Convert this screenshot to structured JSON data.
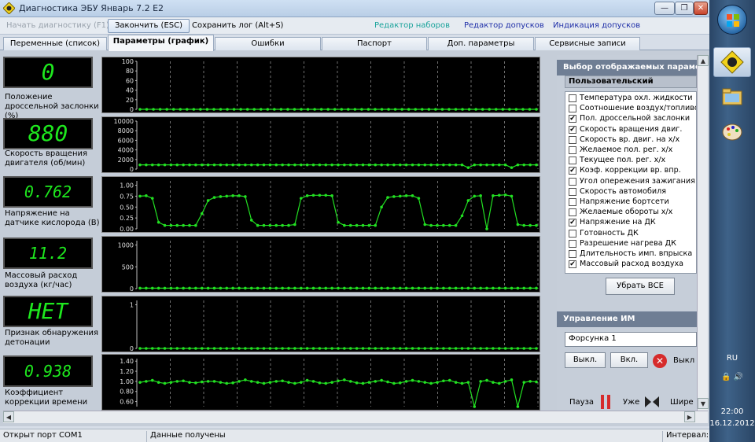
{
  "window": {
    "title": "Диагностика ЭБУ Январь 7.2 E2",
    "controls": {
      "minimize": "—",
      "maximize": "❐",
      "close": "✕"
    }
  },
  "toolbar": {
    "start_diag": "Начать диагностику (F1)",
    "finish": "Закончить (ESC)",
    "save_log": "Сохранить лог (Alt+S)",
    "links": [
      "Редактор наборов",
      "Редактор допусков",
      "Индикация допусков"
    ],
    "link_colors": [
      "#1aa39b",
      "#1f2fa8",
      "#1f2fa8"
    ]
  },
  "tabs": [
    "Переменные (список)",
    "Параметры (график)",
    "Ошибки",
    "Паспорт",
    "Доп. параметры",
    "Сервисные записи"
  ],
  "selected_tab": 1,
  "sensors": [
    {
      "value": "0",
      "label1": "Положение",
      "label2": "дроссельной заслонки",
      "label3": "(%)"
    },
    {
      "value": "880",
      "label1": "Скорость вращения",
      "label2": "двигателя (об/мин)",
      "label3": ""
    },
    {
      "value": "0.762",
      "label1": "Напряжение на",
      "label2": "датчике кислорода (В)",
      "label3": ""
    },
    {
      "value": "11.2",
      "label1": "Массовый расход",
      "label2": "воздуха (кг/час)",
      "label3": ""
    },
    {
      "value": "НЕТ",
      "label1": "Признак обнаружения",
      "label2": "детонации",
      "label3": ""
    },
    {
      "value": "0.938",
      "label1": "Коэффициент",
      "label2": "коррекции времени",
      "label3": ""
    }
  ],
  "chart_data": [
    {
      "type": "line",
      "ylabels": [
        "100",
        "80",
        "60",
        "40",
        "20",
        "0"
      ],
      "ylim": [
        0,
        100
      ],
      "values": [
        0,
        0,
        0,
        0,
        0,
        0,
        0,
        0,
        0,
        0,
        0,
        0,
        0,
        0,
        0,
        0,
        0,
        0,
        0,
        0,
        0,
        0,
        0,
        0,
        0,
        0,
        0,
        0,
        0,
        0,
        0,
        0,
        0,
        0,
        0,
        0,
        0,
        0,
        0,
        0,
        0,
        0,
        0,
        0,
        0,
        0,
        0,
        0,
        0,
        0,
        0,
        0,
        0,
        0,
        0,
        0,
        0,
        0,
        0,
        0
      ]
    },
    {
      "type": "line",
      "ylabels": [
        "10000",
        "8000",
        "6000",
        "4000",
        "2000",
        "0"
      ],
      "ylim": [
        0,
        10000
      ],
      "values": [
        880,
        880,
        880,
        880,
        880,
        880,
        880,
        880,
        880,
        880,
        880,
        880,
        880,
        880,
        880,
        880,
        880,
        880,
        880,
        880,
        880,
        880,
        880,
        880,
        880,
        880,
        880,
        880,
        880,
        880,
        880,
        880,
        880,
        880,
        880,
        880,
        880,
        880,
        880,
        880,
        880,
        880,
        880,
        880,
        880,
        880,
        880,
        880,
        880,
        880,
        880,
        880,
        880,
        300,
        880,
        880,
        880,
        880,
        880,
        880,
        300,
        880,
        880,
        880,
        880
      ]
    },
    {
      "type": "line",
      "ylabels": [
        "1.00",
        "0.75",
        "0.50",
        "0.25",
        "0.00"
      ],
      "ylim": [
        0,
        1.1
      ],
      "values": [
        0.75,
        0.76,
        0.7,
        0.15,
        0.08,
        0.08,
        0.08,
        0.08,
        0.08,
        0.08,
        0.35,
        0.65,
        0.72,
        0.74,
        0.75,
        0.76,
        0.76,
        0.74,
        0.2,
        0.08,
        0.08,
        0.08,
        0.08,
        0.08,
        0.08,
        0.1,
        0.7,
        0.76,
        0.77,
        0.77,
        0.77,
        0.76,
        0.15,
        0.08,
        0.08,
        0.08,
        0.08,
        0.08,
        0.08,
        0.5,
        0.72,
        0.74,
        0.75,
        0.76,
        0.76,
        0.7,
        0.1,
        0.08,
        0.08,
        0.08,
        0.08,
        0.08,
        0.3,
        0.65,
        0.75,
        0.76,
        0.0,
        0.76,
        0.77,
        0.78,
        0.75,
        0.1,
        0.08,
        0.08,
        0.08
      ]
    },
    {
      "type": "line",
      "ylabels": [
        "1000",
        "500",
        "0"
      ],
      "ylim": [
        0,
        1100
      ],
      "values": [
        11,
        11,
        11,
        11,
        11,
        11,
        11,
        11,
        11,
        11,
        11,
        11,
        11,
        11,
        11,
        11,
        11,
        11,
        11,
        11,
        11,
        11,
        11,
        11,
        11,
        11,
        11,
        11,
        11,
        11,
        11,
        11,
        11,
        11,
        11,
        11,
        11,
        11,
        11,
        11,
        11,
        11,
        11,
        11,
        11,
        11,
        11,
        11,
        11,
        11,
        11,
        11,
        11,
        11,
        11,
        11,
        11,
        11,
        11,
        11,
        11,
        11,
        11,
        11,
        11
      ]
    },
    {
      "type": "line",
      "ylabels": [
        "1",
        "0"
      ],
      "ylim": [
        0,
        1.1
      ],
      "values": [
        0,
        0,
        0,
        0,
        0,
        0,
        0,
        0,
        0,
        0,
        0,
        0,
        0,
        0,
        0,
        0,
        0,
        0,
        0,
        0,
        0,
        0,
        0,
        0,
        0,
        0,
        0,
        0,
        0,
        0,
        0,
        0,
        0,
        0,
        0,
        0,
        0,
        0,
        0,
        0,
        0,
        0,
        0,
        0,
        0,
        0,
        0,
        0,
        0,
        0,
        0,
        0,
        0,
        0,
        0,
        0,
        0,
        0,
        0,
        0,
        0,
        0,
        0,
        0,
        0
      ]
    },
    {
      "type": "line",
      "ylabels": [
        "1.40",
        "1.20",
        "1.00",
        "0.80",
        "0.60"
      ],
      "ylim": [
        0.5,
        1.45
      ],
      "values": [
        0.98,
        1.0,
        1.02,
        0.98,
        0.96,
        0.98,
        1.0,
        1.01,
        0.98,
        0.97,
        0.99,
        1.0,
        1.0,
        0.98,
        0.96,
        0.97,
        1.0,
        1.03,
        1.0,
        0.98,
        0.96,
        0.98,
        1.0,
        1.01,
        0.98,
        0.96,
        0.98,
        1.02,
        1.0,
        0.97,
        0.96,
        0.98,
        1.01,
        1.03,
        1.0,
        0.97,
        0.96,
        0.98,
        1.0,
        1.02,
        0.99,
        0.96,
        0.97,
        1.0,
        1.02,
        1.0,
        0.98,
        0.96,
        0.98,
        1.01,
        1.02,
        0.98,
        0.96,
        0.98,
        0.5,
        1.0,
        1.02,
        0.98,
        0.96,
        1.0,
        1.03,
        0.5,
        0.98,
        1.0,
        0.99
      ]
    }
  ],
  "right_panel": {
    "title": "Выбор отображаемых парамет",
    "preset": "Пользовательский",
    "params": [
      {
        "label": "Температура охл. жидкости",
        "checked": false
      },
      {
        "label": "Соотношение воздух/топливо",
        "checked": false
      },
      {
        "label": "Пол. дроссельной заслонки",
        "checked": true
      },
      {
        "label": "Скорость вращения двиг.",
        "checked": true
      },
      {
        "label": "Скорость вр. двиг. на х/х",
        "checked": false
      },
      {
        "label": "Желаемое пол. рег. х/х",
        "checked": false
      },
      {
        "label": "Текущее пол. рег. х/х",
        "checked": false
      },
      {
        "label": "Коэф. коррекции вр. впр.",
        "checked": true
      },
      {
        "label": "Угол опережения зажигания",
        "checked": false
      },
      {
        "label": "Скорость автомобиля",
        "checked": false
      },
      {
        "label": "Напряжение бортсети",
        "checked": false
      },
      {
        "label": "Желаемые обороты х/х",
        "checked": false
      },
      {
        "label": "Напряжение на ДК",
        "checked": true
      },
      {
        "label": "Готовность ДК",
        "checked": false
      },
      {
        "label": "Разрешение нагрева ДК",
        "checked": false
      },
      {
        "label": "Длительность имп. впрыска",
        "checked": false
      },
      {
        "label": "Массовый расход воздуха",
        "checked": true
      }
    ],
    "clear_all": "Убрать ВСЕ",
    "im_title": "Управление ИМ",
    "injector": "Форсунка 1",
    "off_btn": "Выкл.",
    "on_btn": "Вкл.",
    "off_label": "Выкл",
    "pause": "Пауза",
    "narrow": "Уже",
    "wide": "Шире"
  },
  "status": {
    "port": "Открыт порт COM1",
    "data": "Данные получены",
    "interval": "Интервал:"
  },
  "taskbar": {
    "lang": "RU",
    "time": "22:00",
    "date": "16.12.2012"
  },
  "colors": {
    "lcd": "#1ee81e",
    "trace": "#22e022",
    "grid": "#4a4a4a"
  }
}
